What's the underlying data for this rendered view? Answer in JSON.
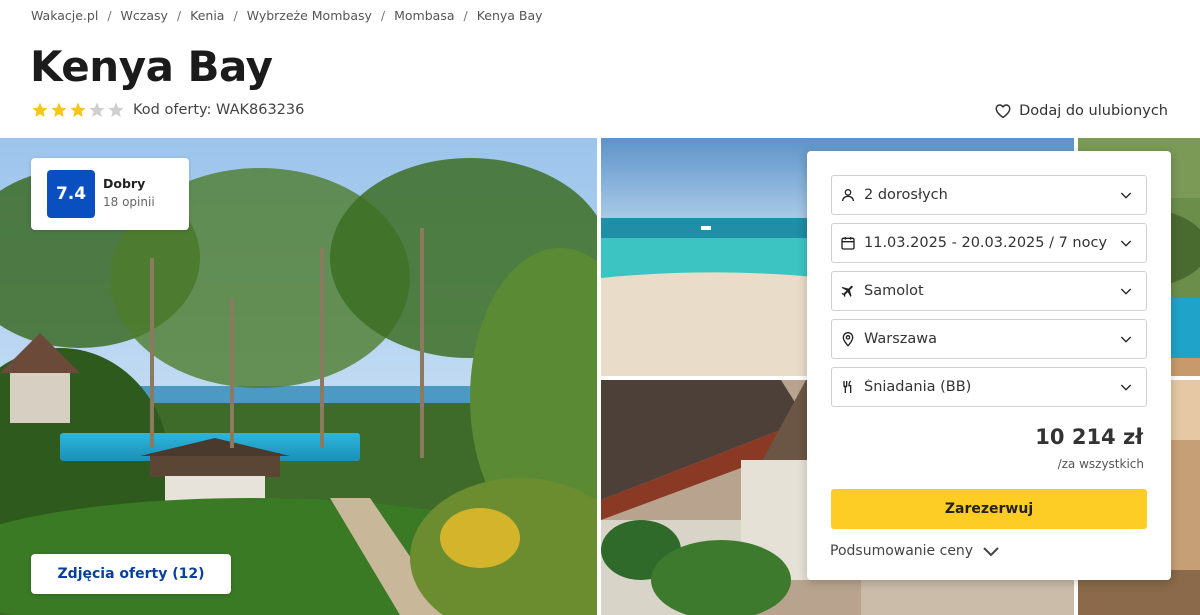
{
  "breadcrumb": [
    "Wakacje.pl",
    "Wczasy",
    "Kenia",
    "Wybrzeże Mombasy",
    "Mombasa",
    "Kenya Bay"
  ],
  "title": "Kenya Bay",
  "stars": {
    "filled": 3,
    "total": 5,
    "filled_color": "#f5c518",
    "empty_color": "#cfcfcf"
  },
  "offer_code": "Kod oferty: WAK863236",
  "favorite_label": "Dodaj do ulubionych",
  "rating": {
    "score": "7.4",
    "label": "Dobry",
    "reviews": "18 opinii",
    "badge_color": "#0a4fbf"
  },
  "photos_button": "Zdjęcia oferty (12)",
  "booking": {
    "fields": [
      {
        "icon": "person-icon",
        "value": "2 dorosłych"
      },
      {
        "icon": "calendar-icon",
        "value": "11.03.2025 - 20.03.2025 / 7 nocy"
      },
      {
        "icon": "plane-icon",
        "value": "Samolot"
      },
      {
        "icon": "location-pin-icon",
        "value": "Warszawa"
      },
      {
        "icon": "cutlery-icon",
        "value": "Śniadania (BB)"
      }
    ],
    "price": "10 214 zł",
    "price_note": "/za wszystkich",
    "reserve_label": "Zarezerwuj",
    "summary_label": "Podsumowanie ceny",
    "reserve_color": "#fdcd26"
  }
}
